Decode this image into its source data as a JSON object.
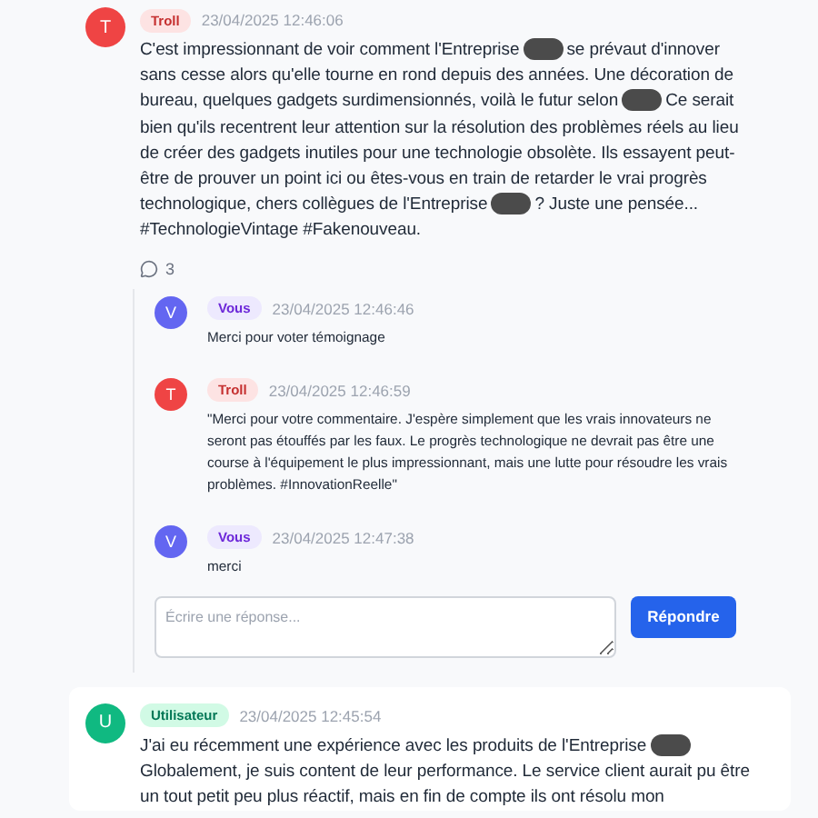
{
  "comments": [
    {
      "initial": "T",
      "role": {
        "label": "Troll",
        "kind": "troll"
      },
      "time": "23/04/2025 12:46:06",
      "body": [
        {
          "kind": "text",
          "text": "C'est impressionnant de voir comment l'Entreprise"
        },
        {
          "kind": "redacted"
        },
        {
          "kind": "text",
          "text": "se prévaut d'innover sans cesse alors qu'elle tourne en rond depuis des années. Une décoration de bureau, quelques gadgets surdimensionnés, voilà le futur selon"
        },
        {
          "kind": "redacted"
        },
        {
          "kind": "text",
          "text": "Ce serait bien qu'ils recentrent leur attention sur la résolution des problèmes réels au lieu de créer des gadgets inutiles pour une technologie obsolète. Ils essayent peut-être de prouver un point ici ou êtes-vous en train de retarder le vrai progrès technologique, chers collègues de l'Entreprise"
        },
        {
          "kind": "redacted"
        },
        {
          "kind": "text",
          "text": "? Juste une pensée... #TechnologieVintage #Fakenouveau."
        }
      ],
      "reply_count": "3",
      "replies": [
        {
          "initial": "V",
          "role": {
            "label": "Vous",
            "kind": "you"
          },
          "time": "23/04/2025 12:46:46",
          "text": "Merci pour voter témoignage"
        },
        {
          "initial": "T",
          "role": {
            "label": "Troll",
            "kind": "troll"
          },
          "time": "23/04/2025 12:46:59",
          "text": "\"Merci pour votre commentaire. J'espère simplement que les vrais innovateurs ne seront pas étouffés par les faux. Le progrès technologique ne devrait pas être une course à l'équipement le plus impressionnant, mais une lutte pour résoudre les vrais problèmes. #InnovationReelle\""
        },
        {
          "initial": "V",
          "role": {
            "label": "Vous",
            "kind": "you"
          },
          "time": "23/04/2025 12:47:38",
          "text": "merci"
        }
      ],
      "reply_form": {
        "placeholder": "Écrire une réponse...",
        "button": "Répondre"
      }
    },
    {
      "initial": "U",
      "role": {
        "label": "Utilisateur",
        "kind": "user"
      },
      "time": "23/04/2025 12:45:54",
      "body": [
        {
          "kind": "text",
          "text": "J'ai eu récemment une expérience avec les produits de l'Entreprise"
        },
        {
          "kind": "redacted"
        },
        {
          "kind": "text",
          "text": "Globalement, je suis content de leur performance. Le service client aurait pu être un tout petit peu plus réactif, mais en fin de compte ils ont résolu mon"
        }
      ]
    }
  ]
}
